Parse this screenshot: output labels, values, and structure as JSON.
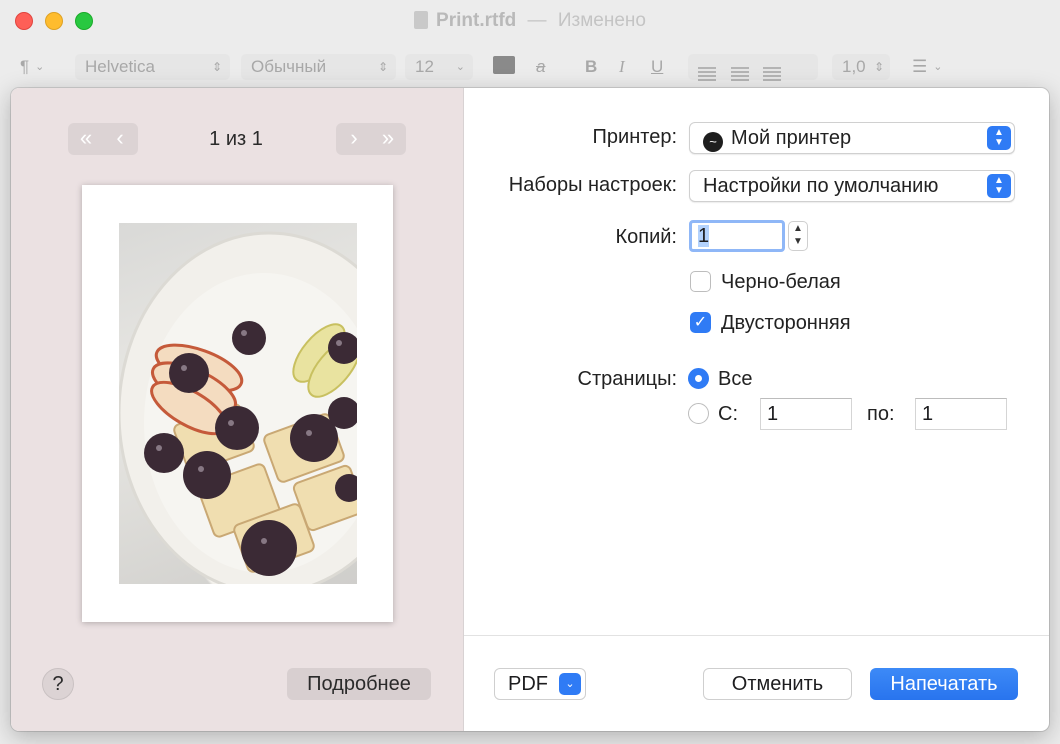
{
  "window": {
    "title": "Print.rtfd",
    "separator": "—",
    "status": "Изменено"
  },
  "toolbar": {
    "paragraph_symbol": "¶",
    "font_family": "Helvetica",
    "font_style": "Обычный",
    "font_size": "12",
    "bold": "B",
    "italic": "I",
    "underline": "U",
    "strike": "a",
    "line_spacing": "1,0"
  },
  "preview": {
    "first_prev": "«‹",
    "next_last": "›»",
    "page_counter": "1 из 1",
    "help": "?",
    "details_button": "Подробнее"
  },
  "settings": {
    "printer_label": "Принтер:",
    "printer_value": "Мой принтер",
    "presets_label": "Наборы настроек:",
    "presets_value": "Настройки по умолчанию",
    "copies_label": "Копий:",
    "copies_value": "1",
    "bw_label": "Черно-белая",
    "bw_checked": false,
    "duplex_label": "Двусторонняя",
    "duplex_checked": true,
    "pages_label": "Страницы:",
    "pages_all": "Все",
    "pages_from_label": "С:",
    "pages_from_value": "1",
    "pages_to_label": "по:",
    "pages_to_value": "1"
  },
  "footer": {
    "pdf_button": "PDF",
    "cancel_button": "Отменить",
    "print_button": "Напечатать"
  },
  "colors": {
    "accent": "#2f7bf5",
    "preview_bg": "#ebe1e2"
  }
}
